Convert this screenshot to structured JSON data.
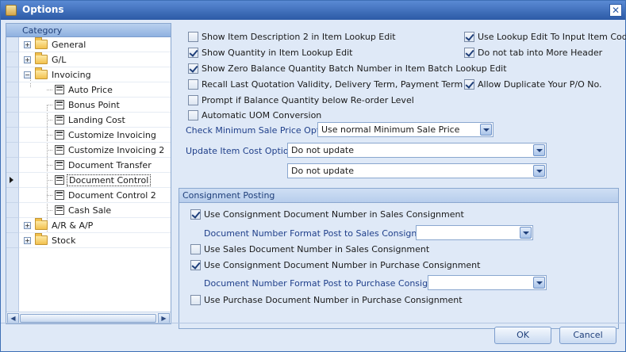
{
  "window": {
    "title": "Options"
  },
  "tree": {
    "header": "Category",
    "items": [
      {
        "label": "General",
        "type": "folder",
        "level": 0,
        "expanded": false
      },
      {
        "label": "G/L",
        "type": "folder",
        "level": 0,
        "expanded": false
      },
      {
        "label": "Invoicing",
        "type": "folder",
        "level": 0,
        "expanded": true
      },
      {
        "label": "Auto Price",
        "type": "doc",
        "level": 1
      },
      {
        "label": "Bonus Point",
        "type": "doc",
        "level": 1
      },
      {
        "label": "Landing Cost",
        "type": "doc",
        "level": 1
      },
      {
        "label": "Customize Invoicing",
        "type": "doc",
        "level": 1
      },
      {
        "label": "Customize Invoicing 2",
        "type": "doc",
        "level": 1
      },
      {
        "label": "Document Transfer",
        "type": "doc",
        "level": 1
      },
      {
        "label": "Document Control",
        "type": "doc",
        "level": 1,
        "selected": true
      },
      {
        "label": "Document Control 2",
        "type": "doc",
        "level": 1
      },
      {
        "label": "Cash Sale",
        "type": "doc",
        "level": 1
      },
      {
        "label": "A/R & A/P",
        "type": "folder",
        "level": 0,
        "expanded": false
      },
      {
        "label": "Stock",
        "type": "folder",
        "level": 0,
        "expanded": false
      }
    ]
  },
  "options": {
    "left": [
      {
        "label": "Show Item Description 2 in Item Lookup Edit",
        "checked": false
      },
      {
        "label": "Show Quantity in Item Lookup Edit",
        "checked": true
      },
      {
        "label": "Show Zero Balance Quantity Batch Number in Item Batch Lookup Edit",
        "checked": true
      },
      {
        "label": "Recall Last Quotation Validity, Delivery Term, Payment Term",
        "checked": false
      },
      {
        "label": "Prompt if Balance Quantity below Re-order Level",
        "checked": false
      },
      {
        "label": "Automatic UOM Conversion",
        "checked": false
      }
    ],
    "right": [
      {
        "label": "Use Lookup Edit To Input Item Code",
        "checked": true
      },
      {
        "label": "Do not tab into More Header",
        "checked": true
      },
      {
        "label": "Allow Duplicate Your P/O No.",
        "checked": true
      }
    ]
  },
  "min_sale_price": {
    "label": "Check Minimum Sale Price Option:",
    "value": "Use normal Minimum Sale Price"
  },
  "update_item_cost": {
    "label": "Update Item Cost Option:",
    "value1": "Do not update",
    "value2": "Do not update"
  },
  "consignment": {
    "title": "Consignment Posting",
    "use_doc_no_sales": {
      "label": "Use Consignment Document Number in Sales Consignment",
      "checked": true
    },
    "format_sales": {
      "label": "Document Number Format Post to Sales Consignment:",
      "value": ""
    },
    "use_sales_doc_no": {
      "label": "Use Sales Document Number in Sales Consignment",
      "checked": false
    },
    "use_doc_no_purchase": {
      "label": "Use Consignment Document Number in Purchase Consignment",
      "checked": true
    },
    "format_purchase": {
      "label": "Document Number Format Post to Purchase Consignment:",
      "value": ""
    },
    "use_purchase_doc_no": {
      "label": "Use Purchase Document Number in Purchase Consignment",
      "checked": false
    }
  },
  "buttons": {
    "ok": "OK",
    "cancel": "Cancel"
  }
}
